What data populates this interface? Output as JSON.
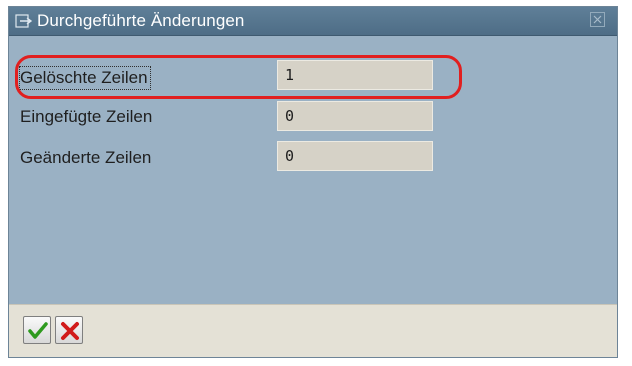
{
  "dialog": {
    "title": "Durchgeführte Änderungen",
    "rows": [
      {
        "label": "Gelöschte Zeilen",
        "value": "1"
      },
      {
        "label": "Eingefügte Zeilen",
        "value": "0"
      },
      {
        "label": "Geänderte Zeilen",
        "value": "0"
      }
    ]
  },
  "footer": {
    "buttons": [
      {
        "icon": "check-icon",
        "color": "#2e9a1e"
      },
      {
        "icon": "cross-icon",
        "color": "#d11a1a"
      }
    ]
  },
  "annotation": {
    "color": "#e11f1f"
  }
}
